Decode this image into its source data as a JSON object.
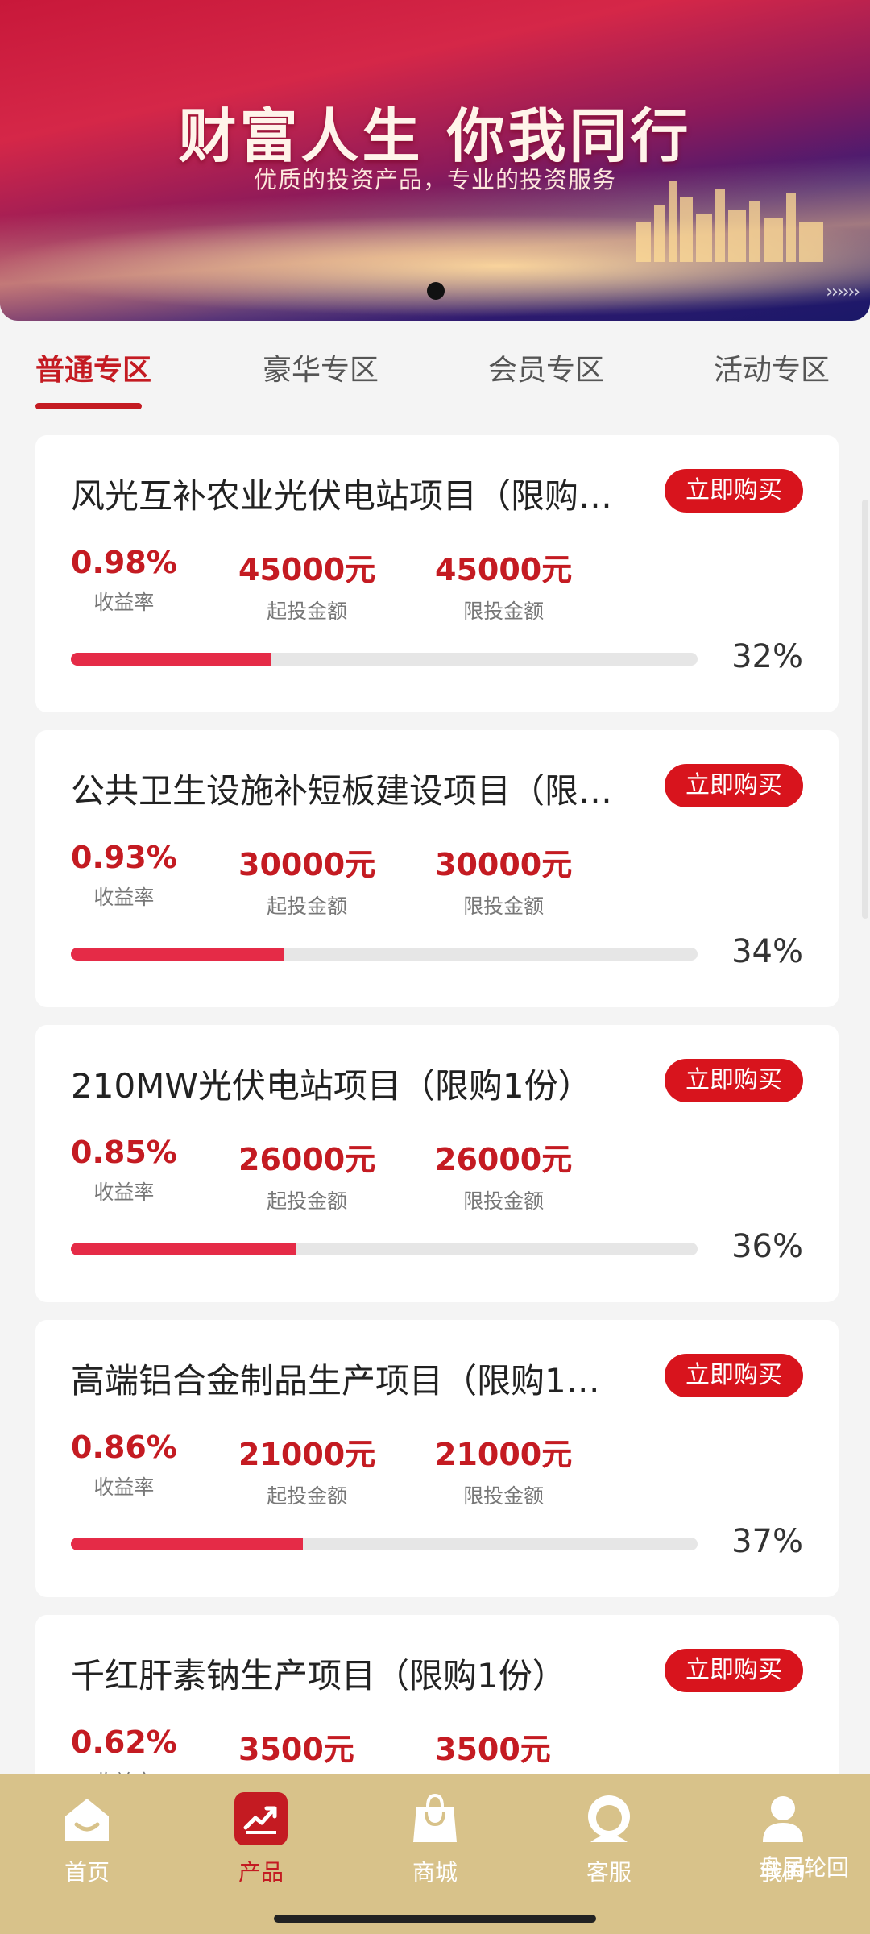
{
  "banner": {
    "title": "财富人生  你我同行",
    "subtitle": "优质的投资产品，专业的投资服务"
  },
  "tabs": [
    {
      "label": "普通专区",
      "active": true
    },
    {
      "label": "豪华专区",
      "active": false
    },
    {
      "label": "会员专区",
      "active": false
    },
    {
      "label": "活动专区",
      "active": false
    }
  ],
  "labels": {
    "rate": "收益率",
    "min_invest": "起投金额",
    "max_invest": "限投金额",
    "buy": "立即购买"
  },
  "products": [
    {
      "title": "风光互补农业光伏电站项目（限购…",
      "rate": "0.98%",
      "min": "45000元",
      "max": "45000元",
      "progress": 32,
      "progress_label": "32%"
    },
    {
      "title": "公共卫生设施补短板建设项目（限…",
      "rate": "0.93%",
      "min": "30000元",
      "max": "30000元",
      "progress": 34,
      "progress_label": "34%"
    },
    {
      "title": "210MW光伏电站项目（限购1份）",
      "rate": "0.85%",
      "min": "26000元",
      "max": "26000元",
      "progress": 36,
      "progress_label": "36%"
    },
    {
      "title": "高端铝合金制品生产项目（限购1…",
      "rate": "0.86%",
      "min": "21000元",
      "max": "21000元",
      "progress": 37,
      "progress_label": "37%"
    },
    {
      "title": "千红肝素钠生产项目（限购1份）",
      "rate": "0.62%",
      "min": "3500元",
      "max": "3500元",
      "progress": null,
      "progress_label": ""
    }
  ],
  "nav": [
    {
      "label": "首页",
      "icon": "home-icon",
      "active": false
    },
    {
      "label": "产品",
      "icon": "chart-icon",
      "active": true
    },
    {
      "label": "商城",
      "icon": "shopping-bag-icon",
      "active": false
    },
    {
      "label": "客服",
      "icon": "customer-service-icon",
      "active": false
    },
    {
      "label": "我的",
      "icon": "user-icon",
      "active": false
    }
  ],
  "watermark": "盘届轮回",
  "colors": {
    "accent": "#c41b22",
    "button": "#d8141d",
    "progress": "#e52b47",
    "nav_bg": "#d8c28a"
  }
}
